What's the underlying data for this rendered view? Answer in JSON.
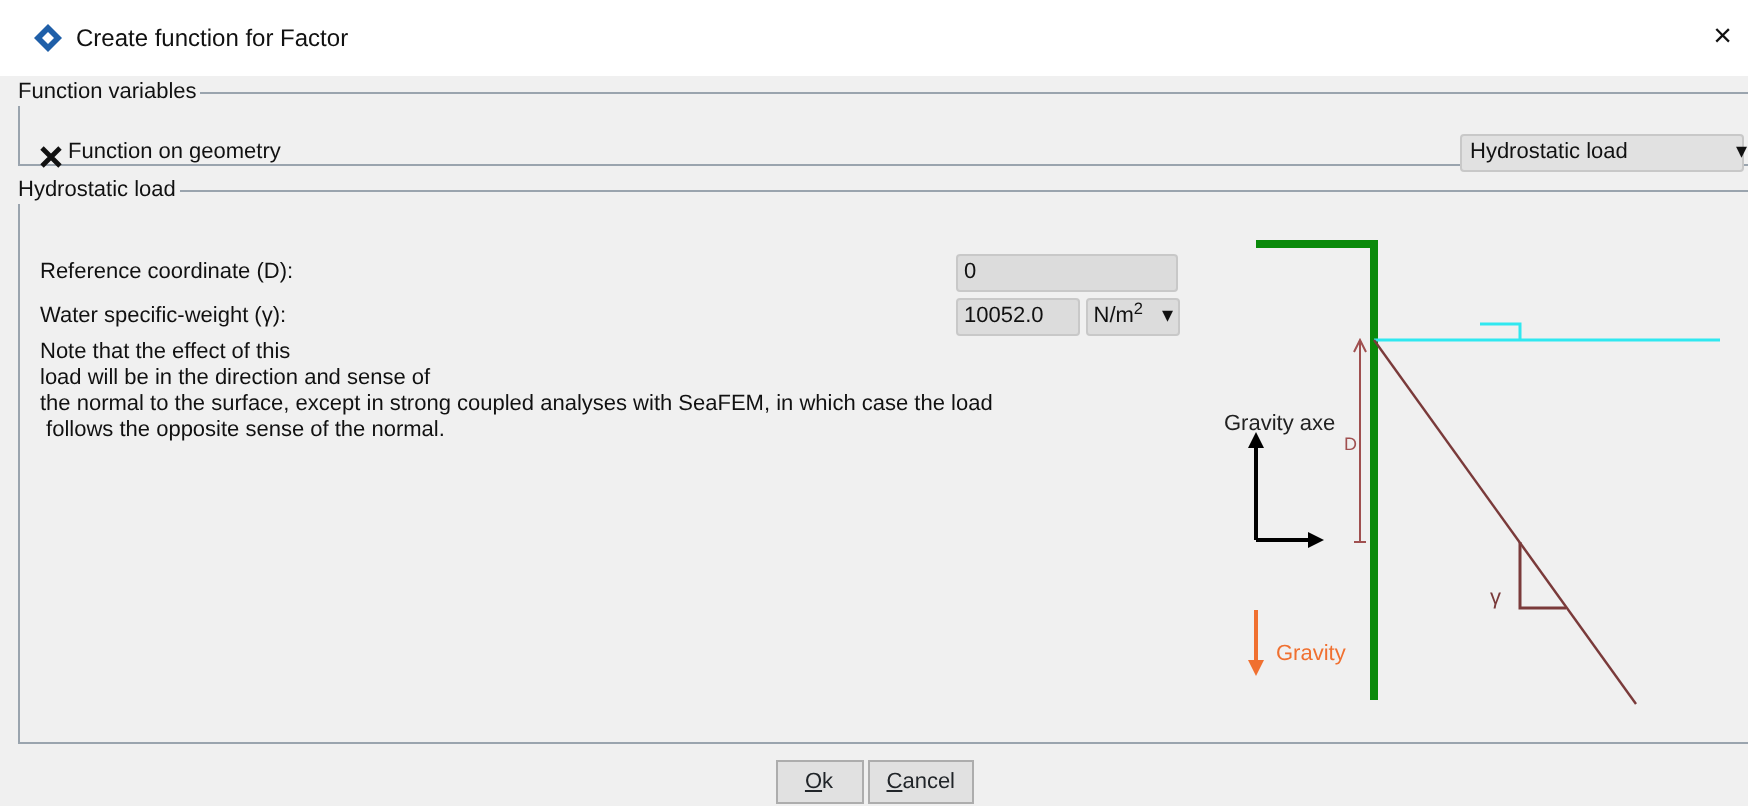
{
  "window": {
    "title": "Create function for Factor",
    "close": "×"
  },
  "function_variables": {
    "legend": "Function variables",
    "checkbox": {
      "label": "Function on geometry",
      "checked": true
    },
    "dropdown": {
      "value": "Hydrostatic load",
      "arrow": "▾"
    }
  },
  "hydrostatic_load": {
    "legend": "Hydrostatic load",
    "fields": [
      {
        "label": "Reference coordinate (D):",
        "value": "0"
      },
      {
        "label": "Water specific-weight (γ):",
        "value": "10052.0",
        "unit": "N/m$^{2}$",
        "arrow": "▾"
      }
    ],
    "note": [
      "Note that the effect of this",
      "load will be in the direction and sense of",
      "the normal to the surface, except in strong coupled analyses with SeaFEM, in which case the load",
      " follows the opposite sense of the normal."
    ],
    "diagram": {
      "axis_label": "Gravity axe",
      "depth_label": "D",
      "weight_label": "γ",
      "gravity_label": "Gravity"
    }
  },
  "buttons": [
    "Ok",
    "Cancel"
  ]
}
